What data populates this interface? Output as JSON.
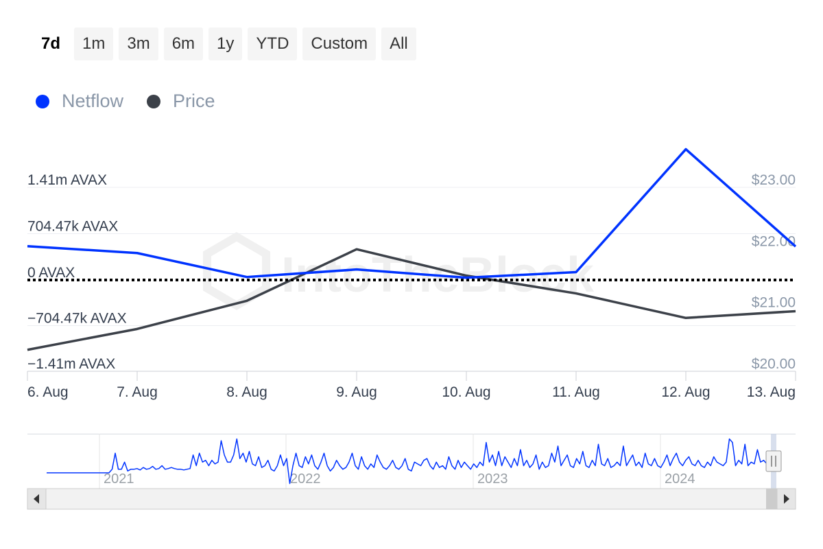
{
  "range_buttons": [
    "7d",
    "1m",
    "3m",
    "6m",
    "1y",
    "YTD",
    "Custom",
    "All"
  ],
  "active_range": "7d",
  "watermark": "IntoTheBlock",
  "colors": {
    "netflow": "#0033ff",
    "price": "#3c4149",
    "zero_line": "#000000"
  },
  "chart_data": {
    "type": "line",
    "title": "",
    "categories": [
      "6. Aug",
      "7. Aug",
      "8. Aug",
      "9. Aug",
      "10. Aug",
      "11. Aug",
      "12. Aug",
      "13. Aug"
    ],
    "series": [
      {
        "name": "Netflow",
        "axis": "left",
        "unit": "AVAX",
        "values": [
          515000,
          410000,
          45000,
          160000,
          35000,
          120000,
          1990000,
          510000
        ]
      },
      {
        "name": "Price",
        "axis": "right",
        "unit": "USD",
        "values": [
          20.35,
          20.69,
          21.15,
          21.99,
          21.56,
          21.27,
          20.87,
          20.98
        ]
      }
    ],
    "y_left": {
      "ticks": [
        "1.41m AVAX",
        "704.47k AVAX",
        "0 AVAX",
        "−704.47k AVAX",
        "−1.41m AVAX"
      ],
      "min": -1410000,
      "max": 1410000
    },
    "y_right": {
      "ticks": [
        "$23.00",
        "$22.00",
        "$21.00",
        "$20.00"
      ],
      "min": 20,
      "max": 23
    },
    "zero_line": "dotted",
    "grid": true,
    "legend_position": "top-left"
  },
  "navigator": {
    "year_labels": [
      "2021",
      "2022",
      "2023",
      "2024"
    ],
    "series": [
      0,
      0,
      0,
      0,
      0,
      0,
      0,
      0,
      0,
      0,
      0,
      0,
      0,
      0,
      0,
      0,
      0,
      0,
      0,
      0,
      0,
      0.1,
      0.55,
      0.1,
      0.1,
      0.3,
      0.05,
      0.1,
      0.1,
      0.12,
      0.08,
      0.15,
      0.1,
      0.12,
      0.18,
      0.1,
      0.12,
      0.2,
      0.1,
      0.12,
      0.15,
      0.12,
      0.1,
      0.1,
      0.08,
      0.1,
      0.12,
      0.5,
      0.2,
      0.55,
      0.3,
      0.35,
      0.2,
      0.35,
      0.25,
      0.3,
      0.9,
      0.5,
      0.3,
      0.3,
      0.5,
      0.95,
      0.4,
      0.55,
      0.3,
      0.6,
      0.25,
      0.2,
      0.45,
      0.15,
      0.2,
      0.35,
      0.1,
      0.05,
      0.2,
      0.5,
      0.2,
      0.4,
      -0.3,
      0.2,
      0.55,
      0.2,
      0.15,
      0.45,
      0.25,
      0.5,
      0.2,
      0.1,
      0.3,
      0.55,
      0.2,
      0.05,
      0.15,
      0.35,
      0.2,
      0.1,
      0.15,
      0.3,
      0.55,
      0.2,
      0.1,
      0.45,
      0.2,
      0.1,
      0.25,
      0.15,
      0.5,
      0.3,
      0.15,
      0.1,
      0.2,
      0.35,
      0.15,
      0.1,
      0.2,
      0.4,
      0.1,
      0.05,
      0.3,
      0.25,
      0.2,
      0.35,
      0.4,
      0.2,
      0.1,
      0.3,
      0.15,
      0.2,
      0.1,
      0.45,
      0.2,
      0.1,
      0.35,
      0.15,
      0.3,
      0.2,
      0.1,
      0.25,
      0.15,
      0.3,
      0.2,
      0.85,
      0.3,
      0.5,
      0.2,
      0.6,
      0.2,
      0.45,
      0.3,
      0.15,
      0.4,
      0.2,
      0.65,
      0.2,
      0.35,
      0.15,
      0.25,
      0.5,
      0.1,
      0.3,
      0.15,
      0.2,
      0.55,
      0.3,
      0.75,
      0.2,
      0.35,
      0.5,
      0.2,
      0.15,
      0.4,
      0.25,
      0.6,
      0.2,
      0.15,
      0.35,
      0.2,
      0.8,
      0.25,
      0.2,
      0.4,
      0.15,
      0.2,
      0.3,
      0.2,
      0.75,
      0.2,
      0.35,
      0.5,
      0.2,
      0.3,
      0.15,
      0.55,
      0.25,
      0.2,
      0.4,
      0.2,
      0.15,
      0.3,
      0.5,
      0.2,
      0.4,
      0.55,
      0.3,
      0.2,
      0.35,
      0.45,
      0.25,
      0.2,
      0.35,
      0.2,
      0.15,
      0.3,
      0.2,
      0.45,
      0.3,
      0.25,
      0.2,
      0.3,
      0.95,
      0.85,
      0.2,
      0.35,
      0.25,
      0.8,
      0.2,
      0.3,
      0.25,
      0.65,
      0.3,
      0.35,
      0.25
    ]
  }
}
